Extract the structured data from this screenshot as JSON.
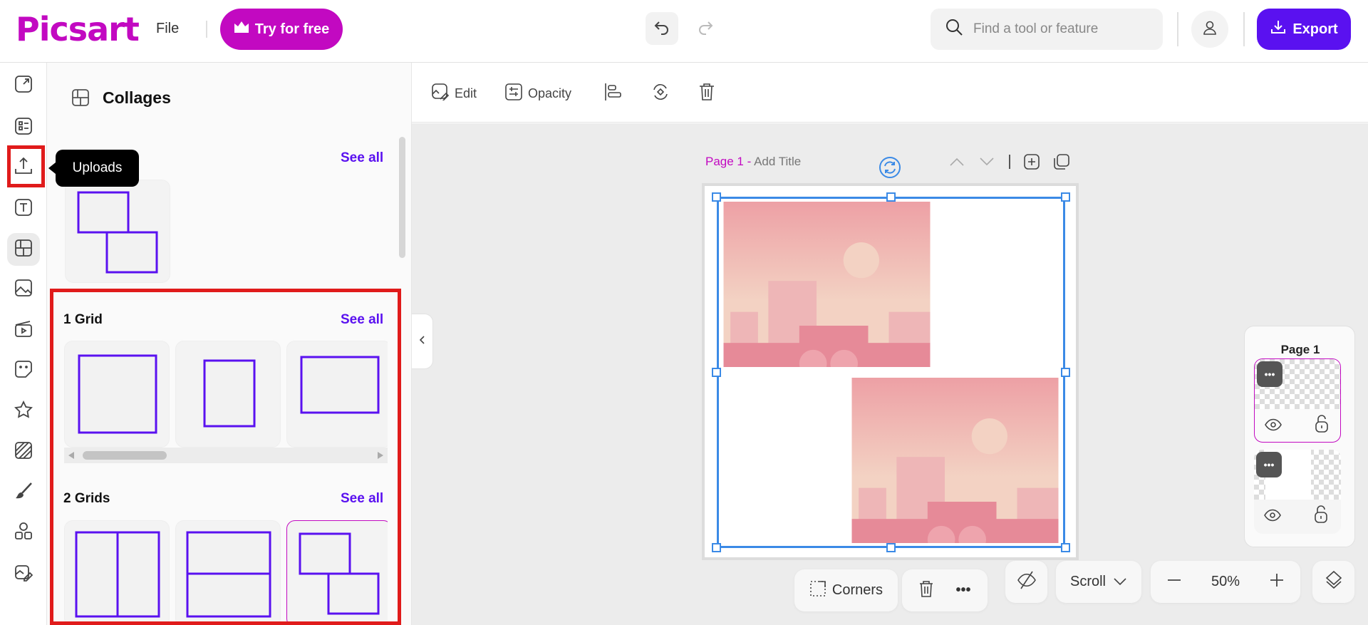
{
  "header": {
    "logo": "Picsart",
    "file": "File",
    "try": "Try for free",
    "search_placeholder": "Find a tool or feature",
    "export": "Export"
  },
  "tooltip": "Uploads",
  "panel": {
    "title": "Collages",
    "top_see_all": "See all",
    "sections": [
      {
        "title": "1 Grid",
        "see_all": "See all"
      },
      {
        "title": "2 Grids",
        "see_all": "See all"
      }
    ]
  },
  "toolbar": {
    "edit": "Edit",
    "opacity": "Opacity"
  },
  "page": {
    "label": "Page 1 -",
    "title_placeholder": "Add Title"
  },
  "layers": {
    "title": "Page 1"
  },
  "bottom": {
    "corners": "Corners",
    "scroll": "Scroll",
    "zoom": "50%"
  },
  "colors": {
    "brand": "#c209c1",
    "accent": "#5a11f0",
    "selection": "#3b8ae6"
  }
}
